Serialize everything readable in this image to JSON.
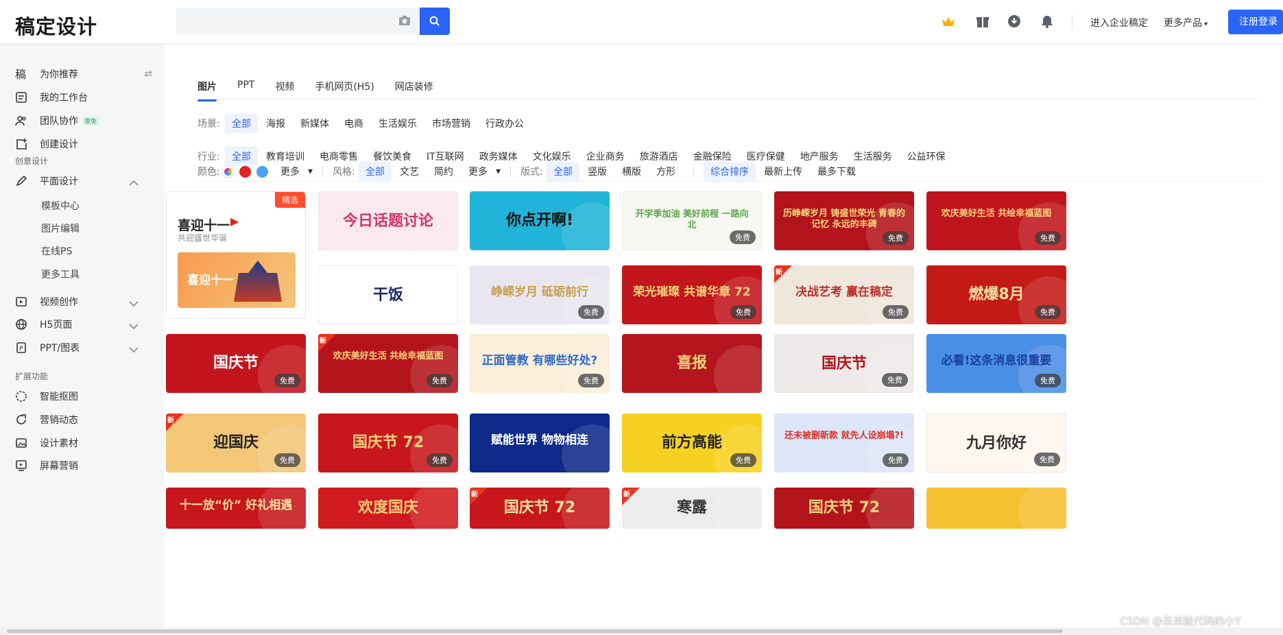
{
  "brand": "稿定设计",
  "search": {
    "placeholder": ""
  },
  "header": {
    "enterprise": "进入企业稿定",
    "more": "更多产品",
    "register": "注册登录"
  },
  "sidebar": {
    "items": [
      {
        "label": "为你推荐",
        "icon": "recommend-icon"
      },
      {
        "label": "我的工作台",
        "icon": "workbench-icon"
      },
      {
        "label": "团队协作",
        "icon": "team-icon",
        "badge": "限免"
      },
      {
        "label": "创建设计",
        "icon": "create-icon"
      }
    ],
    "section1": "创意设计",
    "design": {
      "label": "平面设计",
      "subs": [
        "模板中心",
        "图片编辑",
        "在线PS",
        "更多工具"
      ]
    },
    "more_items": [
      {
        "label": "视频创作"
      },
      {
        "label": "H5页面"
      },
      {
        "label": "PPT/图表"
      }
    ],
    "section2": "扩展功能",
    "ext": [
      {
        "label": "智能抠图"
      },
      {
        "label": "营销动态"
      },
      {
        "label": "设计素材"
      },
      {
        "label": "屏幕营销"
      }
    ]
  },
  "tabs": [
    "图片",
    "PPT",
    "视频",
    "手机网页(H5)",
    "网店装修"
  ],
  "filters": {
    "scene_label": "场景:",
    "scene": [
      "全部",
      "海报",
      "新媒体",
      "电商",
      "生活娱乐",
      "市场营销",
      "行政办公"
    ],
    "industry_label": "行业:",
    "industry": [
      "全部",
      "教育培训",
      "电商零售",
      "餐饮美食",
      "IT互联网",
      "政务媒体",
      "文化娱乐",
      "企业商务",
      "旅游酒店",
      "金融保险",
      "医疗保健",
      "地产服务",
      "生活服务",
      "公益环保"
    ],
    "color_label": "颜色:",
    "color_more": "更多",
    "style_label": "风格:",
    "style": [
      "全部",
      "文艺",
      "简约"
    ],
    "style_more": "更多",
    "format_label": "版式:",
    "format": [
      "全部",
      "竖版",
      "横版",
      "方形"
    ],
    "sort": [
      "综合排序",
      "最新上传",
      "最多下载"
    ]
  },
  "featured": {
    "title": "喜迎十一",
    "subtitle": "共迎盛世华诞",
    "tag": "精选",
    "art": "喜迎十一"
  },
  "free_label": "免费",
  "new_label": "新",
  "cards": [
    {
      "text": "今日话题讨论",
      "bg": "#fbe9ef",
      "color": "#d4336a",
      "free": false,
      "new": false
    },
    {
      "text": "你点开啊!",
      "bg": "#1fb4d8",
      "color": "#111",
      "free": false,
      "new": false
    },
    {
      "text": "开学季加油 美好前程 一路向北",
      "bg": "#f7f7f2",
      "color": "#5ba64b",
      "free": true,
      "new": false
    },
    {
      "text": "历峥嵘岁月 铸盛世荣光 青春的记忆 永远的丰碑",
      "bg": "#b3141b",
      "color": "#f8d77a",
      "free": true,
      "new": false
    },
    {
      "text": "欢庆美好生活 共绘幸福蓝图",
      "bg": "#c1151d",
      "color": "#f8d77a",
      "free": true,
      "new": false
    },
    {
      "text": "干饭",
      "bg": "#ffffff",
      "color": "#1a2a6c",
      "free": false,
      "new": false
    },
    {
      "text": "峥嵘岁月 砥砺前行",
      "bg": "#e9e6ef",
      "color": "#c8a050",
      "free": true,
      "new": false
    },
    {
      "text": "荣光璀璨 共谱华章 72",
      "bg": "#c3161c",
      "color": "#f6d27a",
      "free": true,
      "new": false
    },
    {
      "text": "决战艺考 赢在稿定",
      "bg": "#efe6dc",
      "color": "#c0312b",
      "free": true,
      "new": true
    },
    {
      "text": "燃爆8月",
      "bg": "#c41a16",
      "color": "#fbe0a0",
      "free": true,
      "new": false
    },
    {
      "text": "国庆节",
      "bg": "#c2151c",
      "color": "#fff",
      "free": true,
      "new": false
    },
    {
      "text": "欢庆美好生活 共绘幸福蓝图",
      "bg": "#b3141b",
      "color": "#f8d77a",
      "free": true,
      "new": true
    },
    {
      "text": "正面管教 有哪些好处?",
      "bg": "#fbeed9",
      "color": "#2e6ac9",
      "free": true,
      "new": false
    },
    {
      "text": "喜报",
      "bg": "#b5151c",
      "color": "#f6d27a",
      "free": false,
      "new": false
    },
    {
      "text": "国庆节",
      "bg": "#efeaea",
      "color": "#b3141b",
      "free": true,
      "new": false
    },
    {
      "text": "必看!这条消息很重要",
      "bg": "#4a8fe6",
      "color": "#1a3f9c",
      "free": true,
      "new": false
    },
    {
      "text": "迎国庆",
      "bg": "#f3c776",
      "color": "#222",
      "free": true,
      "new": true
    },
    {
      "text": "国庆节 72",
      "bg": "#c7161c",
      "color": "#f6d27a",
      "free": true,
      "new": false
    },
    {
      "text": "赋能世界 物物相连",
      "bg": "#0d2a8a",
      "color": "#ffffff",
      "free": false,
      "new": false
    },
    {
      "text": "前方高能",
      "bg": "#f7d122",
      "color": "#222",
      "free": true,
      "new": false
    },
    {
      "text": "还未被删新款 就先人设崩塌?!",
      "bg": "#dde6f7",
      "color": "#d9332b",
      "free": true,
      "new": false
    },
    {
      "text": "九月你好",
      "bg": "#fff6ee",
      "color": "#333",
      "free": true,
      "new": false
    },
    {
      "text": "十一放“价” 好礼相遇",
      "bg": "#c7161c",
      "color": "#fbe0a0",
      "free": false,
      "new": false
    },
    {
      "text": "欢度国庆",
      "bg": "#d11a1f",
      "color": "#f6d27a",
      "free": false,
      "new": false
    },
    {
      "text": "国庆节 72",
      "bg": "#c7161c",
      "color": "#fbe0a0",
      "free": false,
      "new": true
    },
    {
      "text": "寒露",
      "bg": "#ececec",
      "color": "#333",
      "free": false,
      "new": true
    },
    {
      "text": "国庆节 72",
      "bg": "#b3141b",
      "color": "#f6d27a",
      "free": false,
      "new": false
    },
    {
      "text": "",
      "bg": "#f5c030",
      "color": "#c1151d",
      "free": false,
      "new": false
    }
  ],
  "watermark": "CSDN @呆呆敲代码的小Y"
}
